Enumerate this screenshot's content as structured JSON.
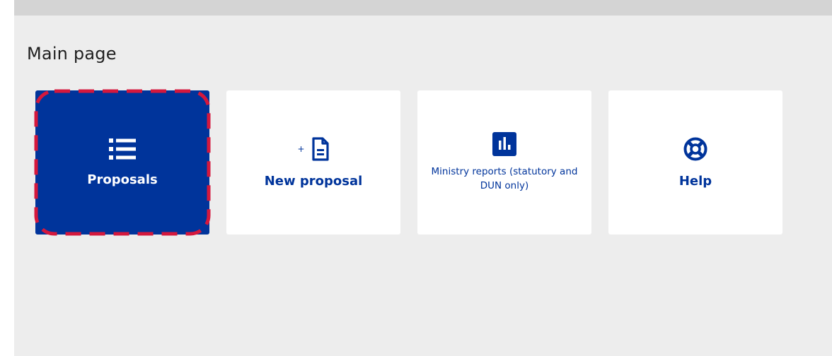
{
  "page": {
    "title": "Main page"
  },
  "tiles": [
    {
      "label": "Proposals",
      "icon": "list-icon",
      "selected": true
    },
    {
      "label": "New proposal",
      "icon": "new-document-icon",
      "prefix": "+"
    },
    {
      "label": "Ministry reports (statutory and DUN only)",
      "icon": "bar-chart-icon"
    },
    {
      "label": "Help",
      "icon": "lifebuoy-icon"
    }
  ],
  "colors": {
    "brand_blue": "#00349b",
    "background": "#ededed",
    "top_bar": "#d4d4d4",
    "focus_ring": "#d4183d",
    "tile_background": "#ffffff"
  }
}
